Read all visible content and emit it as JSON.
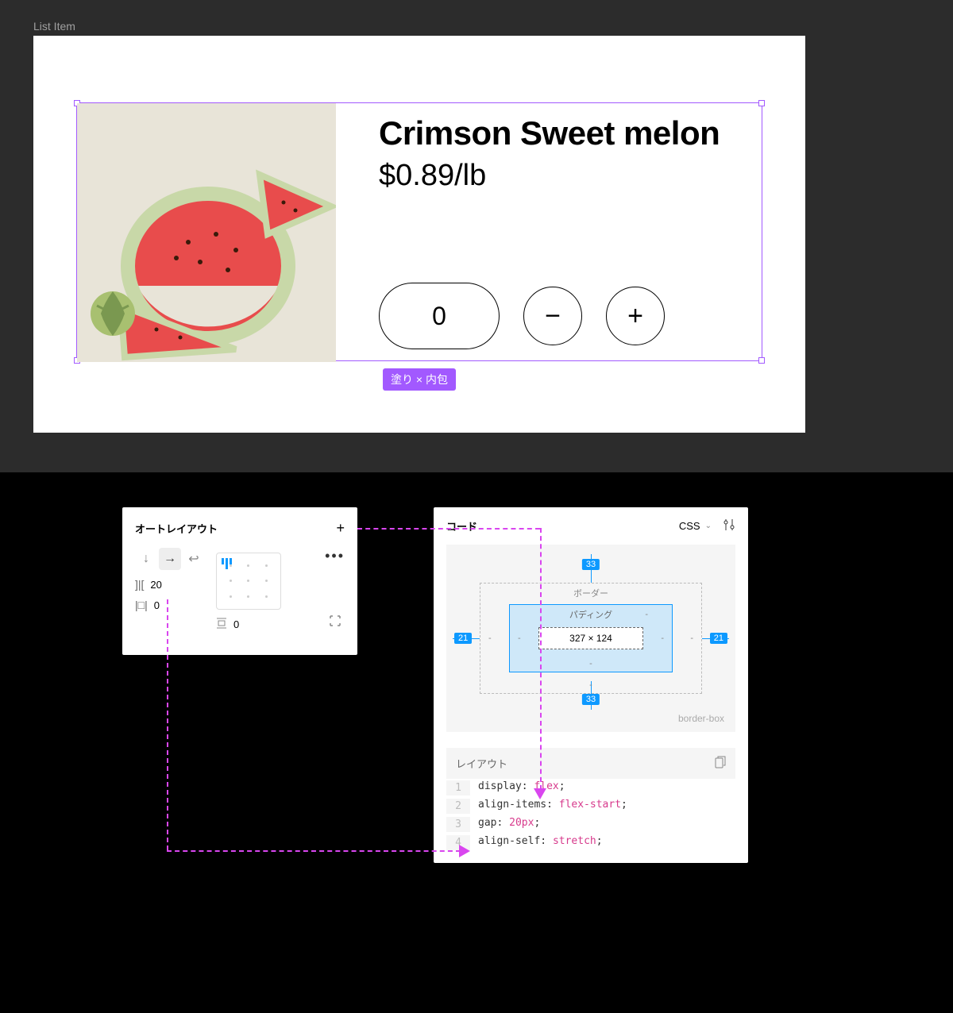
{
  "canvas": {
    "frame_label": "List Item",
    "selection_badge": "塗り × 内包",
    "product": {
      "title": "Crimson Sweet melon",
      "price": "$0.89/lb",
      "quantity": "0",
      "minus": "−",
      "plus": "+"
    }
  },
  "autolayout": {
    "title": "オートレイアウト",
    "gap_value": "20",
    "pad_h": "0",
    "pad_v": "0"
  },
  "code_panel": {
    "title": "コード",
    "language": "CSS",
    "box_model": {
      "border_label": "ボーダー",
      "padding_label": "パディング",
      "content_size": "327 × 124",
      "margin_top": "33",
      "margin_bottom": "33",
      "margin_left": "21",
      "margin_right": "21",
      "box_sizing": "border-box"
    },
    "layout_title": "レイアウト",
    "lines": [
      {
        "no": "1",
        "prop": "display",
        "val": "flex"
      },
      {
        "no": "2",
        "prop": "align-items",
        "val": "flex-start"
      },
      {
        "no": "3",
        "prop": "gap",
        "val": "20px"
      },
      {
        "no": "4",
        "prop": "align-self",
        "val": "stretch"
      }
    ]
  }
}
